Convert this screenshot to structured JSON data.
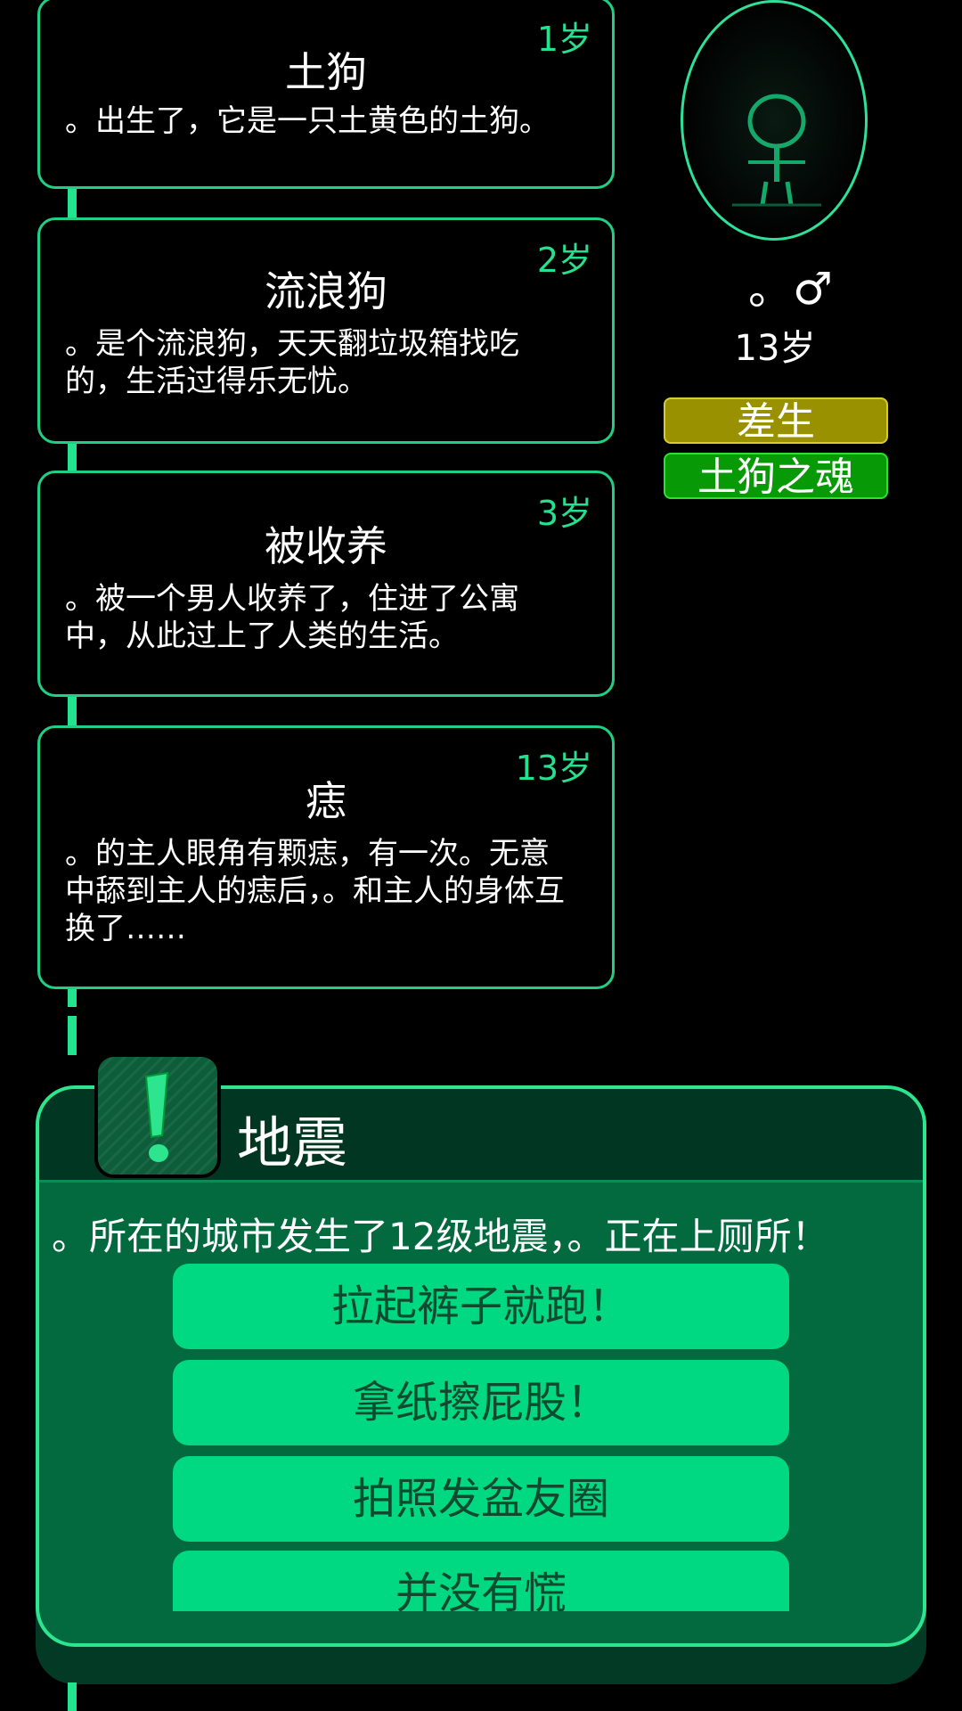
{
  "timeline": [
    {
      "age": "1岁",
      "title": "土狗",
      "desc": "。出生了，它是一只土黄色的土狗。"
    },
    {
      "age": "2岁",
      "title": "流浪狗",
      "desc": "。是个流浪狗，天天翻垃圾箱找吃的，生活过得乐无忧。"
    },
    {
      "age": "3岁",
      "title": "被收养",
      "desc": "。被一个男人收养了，住进了公寓中，从此过上了人类的生活。"
    },
    {
      "age": "13岁",
      "title": "痣",
      "desc": "。的主人眼角有颗痣，有一次。无意中舔到主人的痣后，。和主人的身体互换了……"
    }
  ],
  "profile": {
    "name_sex": "。♂",
    "age": "13岁",
    "tags": [
      "差生",
      "土狗之魂"
    ]
  },
  "event": {
    "title": "地震",
    "desc": "。所在的城市发生了12级地震，。正在上厕所！",
    "choices": [
      "拉起裤子就跑！",
      "拿纸擦屁股！",
      "拍照发盆友圈",
      "并没有慌"
    ]
  },
  "colors": {
    "accent": "#23e38f",
    "badge_gold": "#9a9100",
    "badge_green": "#089a06",
    "choice_bg": "#00d882"
  }
}
